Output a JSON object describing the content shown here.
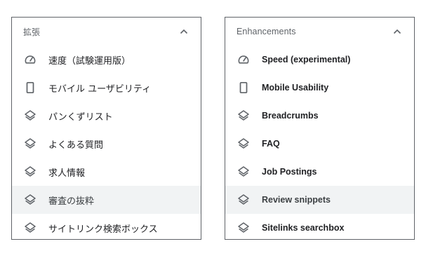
{
  "colors": {
    "border": "#5f6368",
    "icon": "#5f6368",
    "selected_bg": "#f1f3f4",
    "text": "#202124",
    "header_text": "#5f6368"
  },
  "panel_ja": {
    "title": "拡張",
    "items": [
      {
        "label": "速度（試験運用版）",
        "icon": "speed-gauge-icon",
        "selected": false
      },
      {
        "label": "モバイル ユーザビリティ",
        "icon": "mobile-phone-icon",
        "selected": false
      },
      {
        "label": "パンくずリスト",
        "icon": "layers-icon",
        "selected": false
      },
      {
        "label": "よくある質問",
        "icon": "layers-icon",
        "selected": false
      },
      {
        "label": "求人情報",
        "icon": "layers-icon",
        "selected": false
      },
      {
        "label": "審査の抜粋",
        "icon": "layers-icon",
        "selected": true
      },
      {
        "label": "サイトリンク検索ボックス",
        "icon": "layers-icon",
        "selected": false
      }
    ]
  },
  "panel_en": {
    "title": "Enhancements",
    "items": [
      {
        "label": "Speed (experimental)",
        "icon": "speed-gauge-icon",
        "selected": false
      },
      {
        "label": "Mobile Usability",
        "icon": "mobile-phone-icon",
        "selected": false
      },
      {
        "label": "Breadcrumbs",
        "icon": "layers-icon",
        "selected": false
      },
      {
        "label": "FAQ",
        "icon": "layers-icon",
        "selected": false
      },
      {
        "label": "Job Postings",
        "icon": "layers-icon",
        "selected": false
      },
      {
        "label": "Review snippets",
        "icon": "layers-icon",
        "selected": true
      },
      {
        "label": "Sitelinks searchbox",
        "icon": "layers-icon",
        "selected": false
      }
    ]
  }
}
